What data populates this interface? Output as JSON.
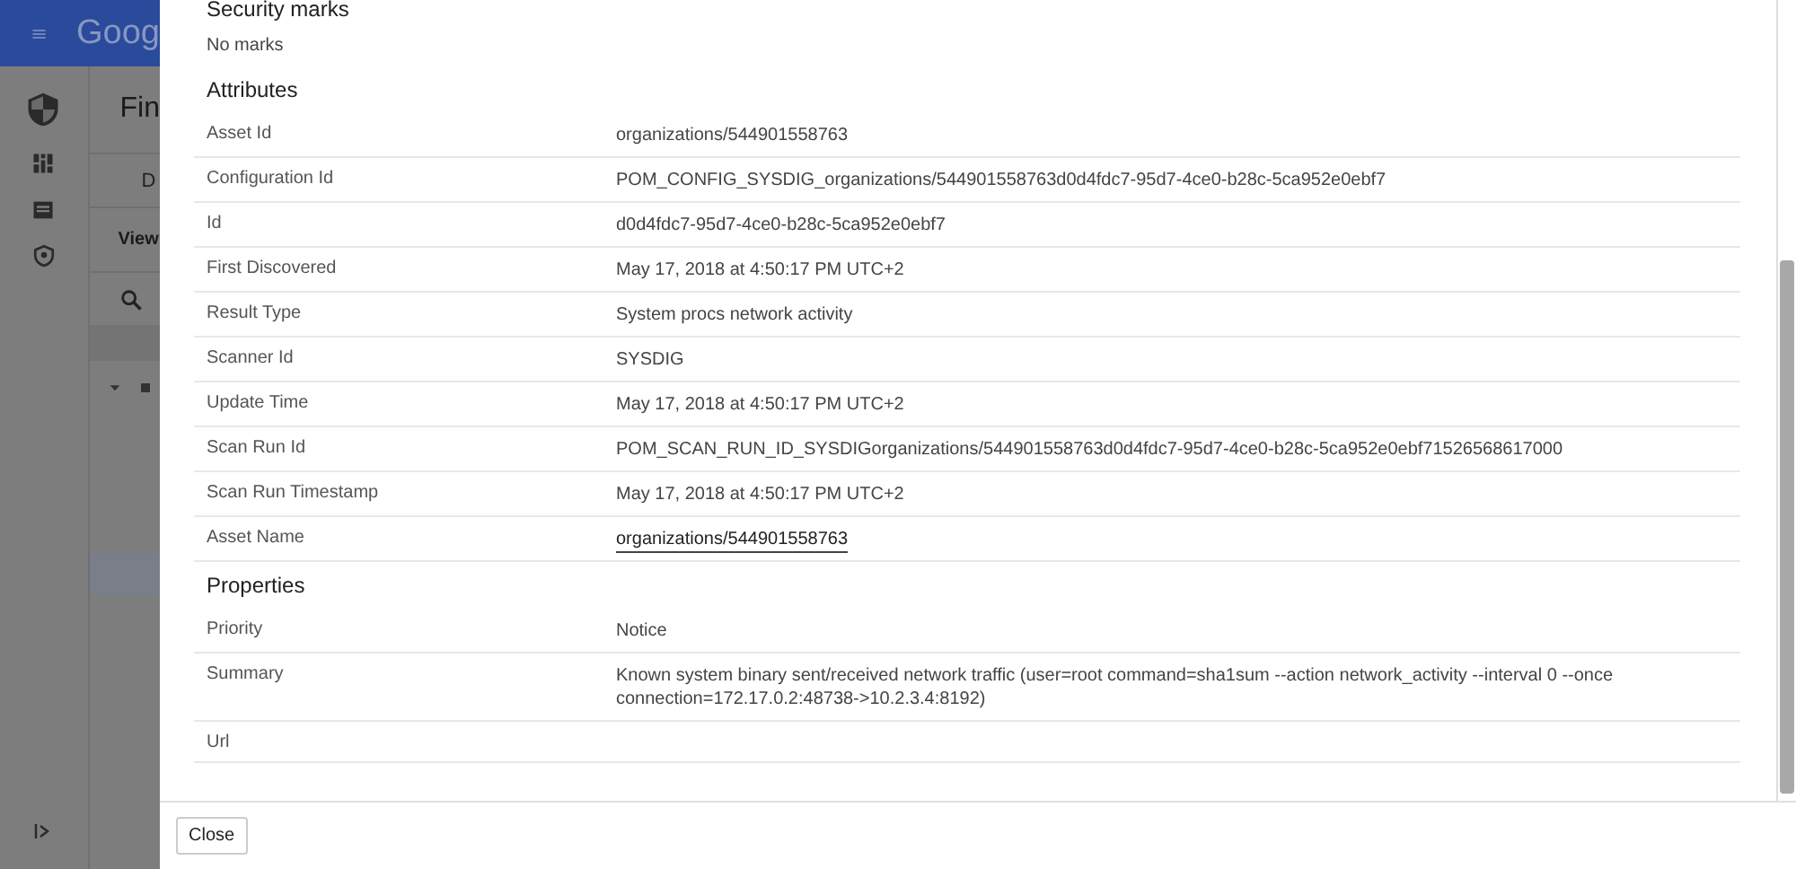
{
  "app": {
    "brand": "Goog",
    "page_title": "Fin",
    "tab": "D",
    "view_label": "View"
  },
  "dialog": {
    "sections": [
      {
        "title": "Security marks",
        "text": "No marks"
      },
      {
        "title": "Attributes",
        "rows": [
          {
            "label": "Asset Id",
            "value": "organizations/544901558763"
          },
          {
            "label": "Configuration Id",
            "value": "POM_CONFIG_SYSDIG_organizations/544901558763d0d4fdc7-95d7-4ce0-b28c-5ca952e0ebf7"
          },
          {
            "label": "Id",
            "value": "d0d4fdc7-95d7-4ce0-b28c-5ca952e0ebf7"
          },
          {
            "label": "First Discovered",
            "value": "May 17, 2018 at 4:50:17 PM UTC+2"
          },
          {
            "label": "Result Type",
            "value": "System procs network activity"
          },
          {
            "label": "Scanner Id",
            "value": "SYSDIG"
          },
          {
            "label": "Update Time",
            "value": "May 17, 2018 at 4:50:17 PM UTC+2"
          },
          {
            "label": "Scan Run Id",
            "value": "POM_SCAN_RUN_ID_SYSDIGorganizations/544901558763d0d4fdc7-95d7-4ce0-b28c-5ca952e0ebf71526568617000"
          },
          {
            "label": "Scan Run Timestamp",
            "value": "May 17, 2018 at 4:50:17 PM UTC+2"
          },
          {
            "label": "Asset Name",
            "value": "organizations/544901558763",
            "kind": "link"
          }
        ]
      },
      {
        "title": "Properties",
        "rows": [
          {
            "label": "Priority",
            "value": "Notice"
          },
          {
            "label": "Summary",
            "value": "Known system binary sent/received network traffic (user=root command=sha1sum --action network_activity --interval 0 --once connection=172.17.0.2:48738->10.2.3.4:8192)"
          },
          {
            "label": "Url"
          }
        ]
      }
    ],
    "close_button": "Close"
  }
}
